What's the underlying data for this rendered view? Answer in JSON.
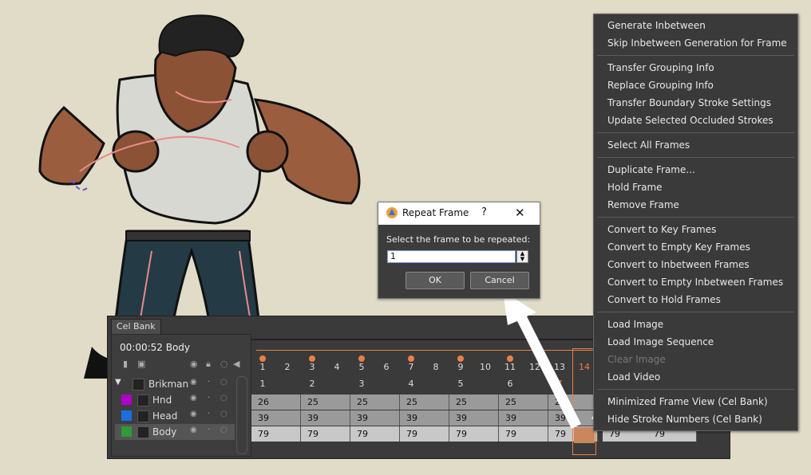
{
  "dialog": {
    "title": "Repeat Frame",
    "help": "?",
    "close": "✕",
    "label": "Select the frame to be repeated:",
    "value": "1",
    "ok": "OK",
    "cancel": "Cancel"
  },
  "celbank": {
    "tab": "Cel Bank",
    "time": "00:00:52  Body",
    "layers": [
      {
        "name": "Brikman",
        "color": "#2a2a2a"
      },
      {
        "name": "Hnd",
        "color": "#b000c8"
      },
      {
        "name": "Head",
        "color": "#1a6ee0"
      },
      {
        "name": "Body",
        "color": "#2e9a3a"
      }
    ],
    "frame_numbers": [
      "1",
      "2",
      "3",
      "4",
      "5",
      "6",
      "7",
      "8",
      "9",
      "10",
      "11",
      "12",
      "13",
      "14"
    ],
    "key_numbers": [
      "1",
      "2",
      "3",
      "4",
      "5",
      "6",
      "7"
    ],
    "rows": [
      [
        "26",
        "25",
        "25",
        "25",
        "25",
        "25",
        "25"
      ],
      [
        "39",
        "39",
        "39",
        "39",
        "39",
        "39",
        "39"
      ],
      [
        "79",
        "79",
        "79",
        "79",
        "79",
        "79",
        "79",
        "79",
        "79"
      ]
    ]
  },
  "menu": {
    "items": [
      {
        "label": "Generate Inbetween"
      },
      {
        "label": "Skip Inbetween Generation for Frame"
      },
      {
        "label": "Transfer Grouping Info"
      },
      {
        "label": "Replace Grouping Info"
      },
      {
        "label": "Transfer Boundary Stroke Settings"
      },
      {
        "label": "Update Selected Occluded Strokes"
      },
      {
        "label": "Select All Frames"
      },
      {
        "label": "Duplicate Frame..."
      },
      {
        "label": "Hold Frame"
      },
      {
        "label": "Remove Frame"
      },
      {
        "label": "Convert to Key Frames"
      },
      {
        "label": "Convert to Empty Key Frames"
      },
      {
        "label": "Convert to Inbetween Frames"
      },
      {
        "label": "Convert to Empty Inbetween Frames"
      },
      {
        "label": "Convert to Hold Frames"
      },
      {
        "label": "Load Image"
      },
      {
        "label": "Load Image Sequence"
      },
      {
        "label": "Clear Image",
        "disabled": true
      },
      {
        "label": "Load Video"
      },
      {
        "label": "Minimized Frame View (Cel Bank)"
      },
      {
        "label": "Hide Stroke Numbers (Cel Bank)"
      }
    ]
  },
  "colors": {
    "accent": "#e8804a",
    "menu_bg": "#3a3a3a",
    "canvas_bg": "#e0dcc8"
  }
}
